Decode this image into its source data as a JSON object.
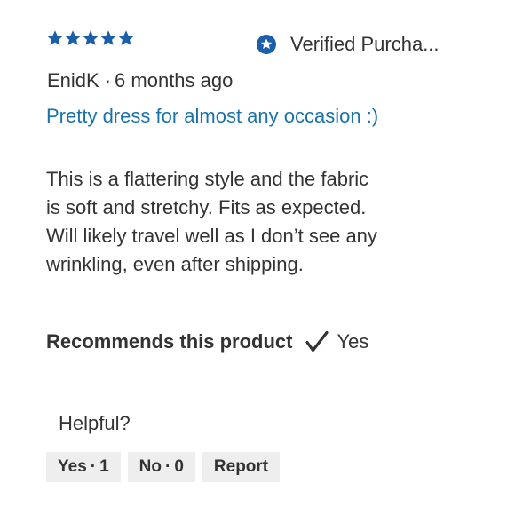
{
  "review": {
    "rating": 5,
    "rating_max": 5,
    "star_color": "#1a5fa8",
    "star_icons": [
      "star-icon",
      "star-icon",
      "star-icon",
      "star-icon",
      "star-icon"
    ],
    "verified": {
      "icon": "verified-star-badge-icon",
      "label": "Verified Purcha..."
    },
    "author": "EnidK",
    "separator": "·",
    "time_ago": "6 months ago",
    "title": "Pretty dress for almost any occasion :)",
    "title_color": "#1a73a8",
    "body_lines": [
      "This is a flattering style and the fabric",
      "is soft and stretchy. Fits as expected.",
      "Will likely travel well as I don’t see any",
      "wrinkling, even after shipping."
    ],
    "recommends": {
      "label": "Recommends this product",
      "icon": "checkmark-icon",
      "value": "Yes"
    },
    "helpful": {
      "label": "Helpful?",
      "yes_label": "Yes",
      "yes_count": "1",
      "no_label": "No",
      "no_count": "0",
      "dot": "·",
      "report_label": "Report"
    }
  }
}
